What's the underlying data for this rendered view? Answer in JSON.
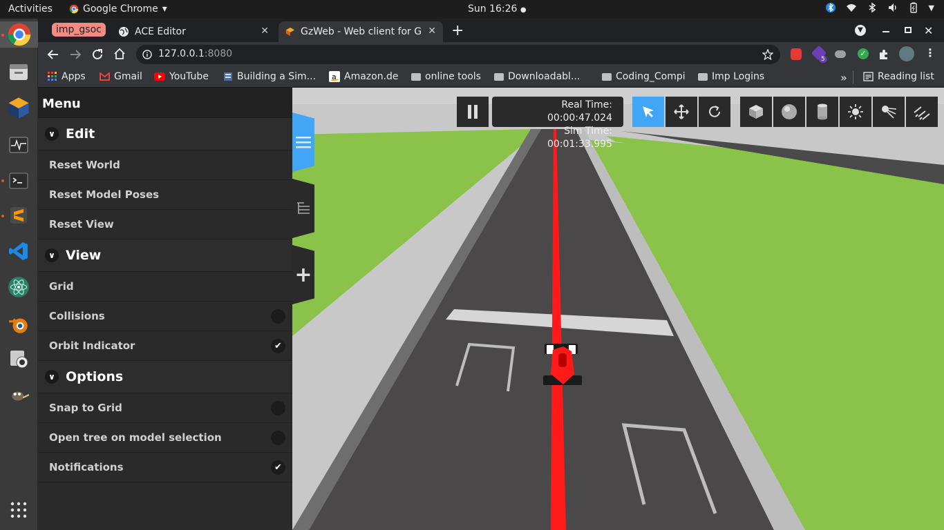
{
  "system": {
    "activities": "Activities",
    "app_name": "Google Chrome",
    "clock": "Sun 16:26"
  },
  "browser": {
    "tab_group": "imp_gsoc",
    "tabs": [
      {
        "title": "ACE Editor"
      },
      {
        "title": "GzWeb - Web client for Ga"
      }
    ],
    "url_host": "127.0.0.1",
    "url_port": ":8080",
    "extension_badge": "5",
    "bookmarks": [
      {
        "label": "Apps",
        "icon": "apps-grid-icon"
      },
      {
        "label": "Gmail",
        "icon": "gmail-icon"
      },
      {
        "label": "YouTube",
        "icon": "youtube-icon"
      },
      {
        "label": "Building a Sim...",
        "icon": "page-icon"
      },
      {
        "label": "Amazon.de",
        "icon": "amazon-icon"
      },
      {
        "label": "online tools",
        "icon": "folder-icon"
      },
      {
        "label": "Downloadabl...",
        "icon": "folder-icon"
      },
      {
        "label": "Coding_Compi",
        "icon": "folder-icon"
      },
      {
        "label": "Imp Logins",
        "icon": "folder-icon"
      }
    ],
    "more_bookmarks": "»",
    "reading_list": "Reading list"
  },
  "gzweb": {
    "menu_title": "Menu",
    "sections": [
      {
        "title": "Edit",
        "items": [
          {
            "label": "Reset World"
          },
          {
            "label": "Reset Model Poses"
          },
          {
            "label": "Reset View"
          }
        ]
      },
      {
        "title": "View",
        "items": [
          {
            "label": "Grid"
          },
          {
            "label": "Collisions",
            "checked": false
          },
          {
            "label": "Orbit Indicator",
            "checked": true
          }
        ]
      },
      {
        "title": "Options",
        "items": [
          {
            "label": "Snap to Grid",
            "checked": false
          },
          {
            "label": "Open tree on model selection",
            "checked": false
          },
          {
            "label": "Notifications",
            "checked": true
          }
        ]
      }
    ],
    "real_time": "Real Time: 00:00:47.024",
    "sim_time": "Sim Time: 00:01:33.995",
    "colors": {
      "accent": "#42a5f5",
      "grass": "#8bc34a",
      "track": "#4a4848",
      "car": "#ff1a1a"
    }
  }
}
